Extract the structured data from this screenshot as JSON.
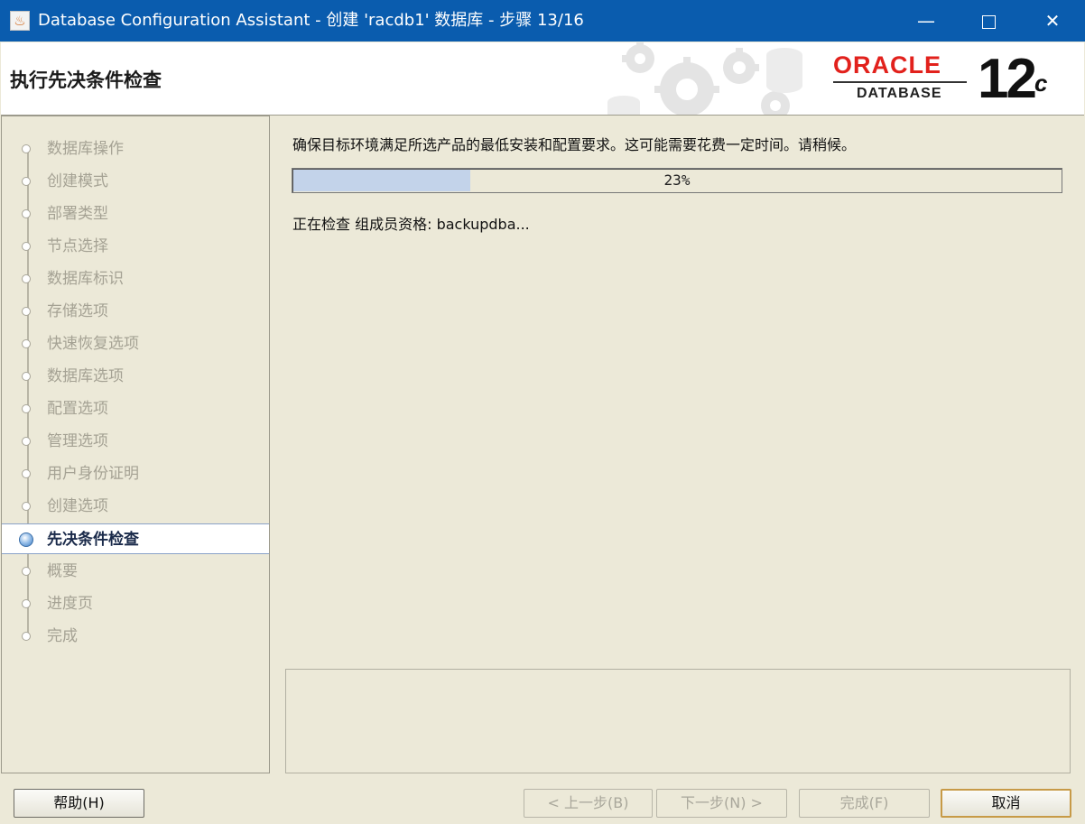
{
  "window": {
    "title": "Database Configuration Assistant - 创建 'racdb1' 数据库 - 步骤 13/16",
    "minimize_glyph": "—",
    "close_glyph": "✕",
    "app_icon": "java-cup-icon"
  },
  "header": {
    "heading": "执行先决条件检查",
    "oracle_word": "ORACLE",
    "database_word": "DATABASE",
    "version": "12",
    "version_suffix": "c"
  },
  "steps": [
    {
      "label": "数据库操作",
      "state": "done"
    },
    {
      "label": "创建模式",
      "state": "done"
    },
    {
      "label": "部署类型",
      "state": "done"
    },
    {
      "label": "节点选择",
      "state": "done"
    },
    {
      "label": "数据库标识",
      "state": "done"
    },
    {
      "label": "存储选项",
      "state": "done"
    },
    {
      "label": "快速恢复选项",
      "state": "done"
    },
    {
      "label": "数据库选项",
      "state": "done"
    },
    {
      "label": "配置选项",
      "state": "done"
    },
    {
      "label": "管理选项",
      "state": "done"
    },
    {
      "label": "用户身份证明",
      "state": "done"
    },
    {
      "label": "创建选项",
      "state": "done"
    },
    {
      "label": "先决条件检查",
      "state": "active"
    },
    {
      "label": "概要",
      "state": "pending"
    },
    {
      "label": "进度页",
      "state": "pending"
    },
    {
      "label": "完成",
      "state": "pending"
    }
  ],
  "main": {
    "instruction": "确保目标环境满足所选产品的最低安装和配置要求。这可能需要花费一定时间。请稍候。",
    "progress_percent": 23,
    "progress_text": "23%",
    "status": "正在检查 组成员资格: backupdba..."
  },
  "buttons": {
    "help": "帮助(H)",
    "prev": "< 上一步(B)",
    "next": "下一步(N) >",
    "finish": "完成(F)",
    "cancel": "取消"
  },
  "colors": {
    "titlebar": "#0a5cae",
    "oracle_red": "#e2211c",
    "progress_fill": "#c3d3ea",
    "panel_bg": "#ece9d8"
  }
}
